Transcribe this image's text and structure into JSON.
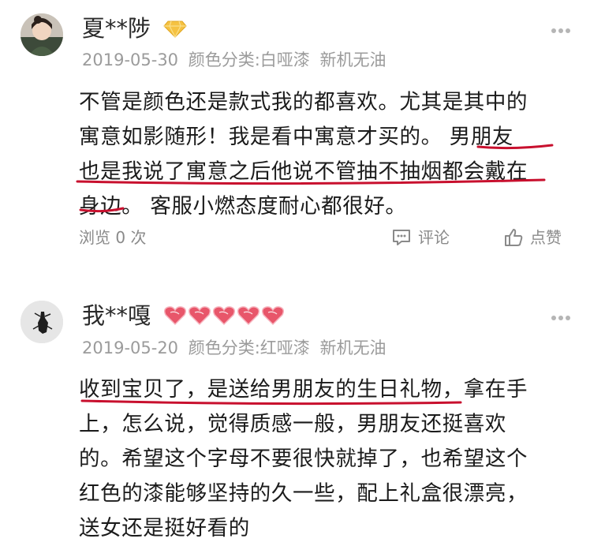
{
  "reviews": [
    {
      "username": "夏**陟",
      "date": "2019-05-30",
      "variant": "颜色分类:白哑漆",
      "condition": "新机无油",
      "lines": [
        "不管是颜色还是款式我的都喜欢。尤其是其中的",
        "寓意如影随形！我是看中寓意才买的。 男朋友",
        "也是我说了寓意之后他说不管抽不抽烟都会戴在",
        "身边。 客服小燃态度耐心都很好。"
      ],
      "views": "浏览 0 次",
      "comment_label": "评论",
      "like_label": "点赞"
    },
    {
      "username": "我**嘎",
      "date": "2019-05-20",
      "variant": "颜色分类:红哑漆",
      "condition": "新机无油",
      "lines": [
        "收到宝贝了，是送给男朋友的生日礼物，拿在手",
        "上，怎么说，觉得质感一般，男朋友还挺喜欢",
        "的。希望这个字母不要很快就掉了，也希望这个",
        "红色的漆能够坚持的久一些，配上礼盒很漂亮，",
        "送女还是挺好看的"
      ]
    }
  ],
  "colors": {
    "underline": "#c8102e",
    "meta": "#9b9b9b",
    "heart": "#e8566a",
    "diamond": "#f5c242"
  }
}
